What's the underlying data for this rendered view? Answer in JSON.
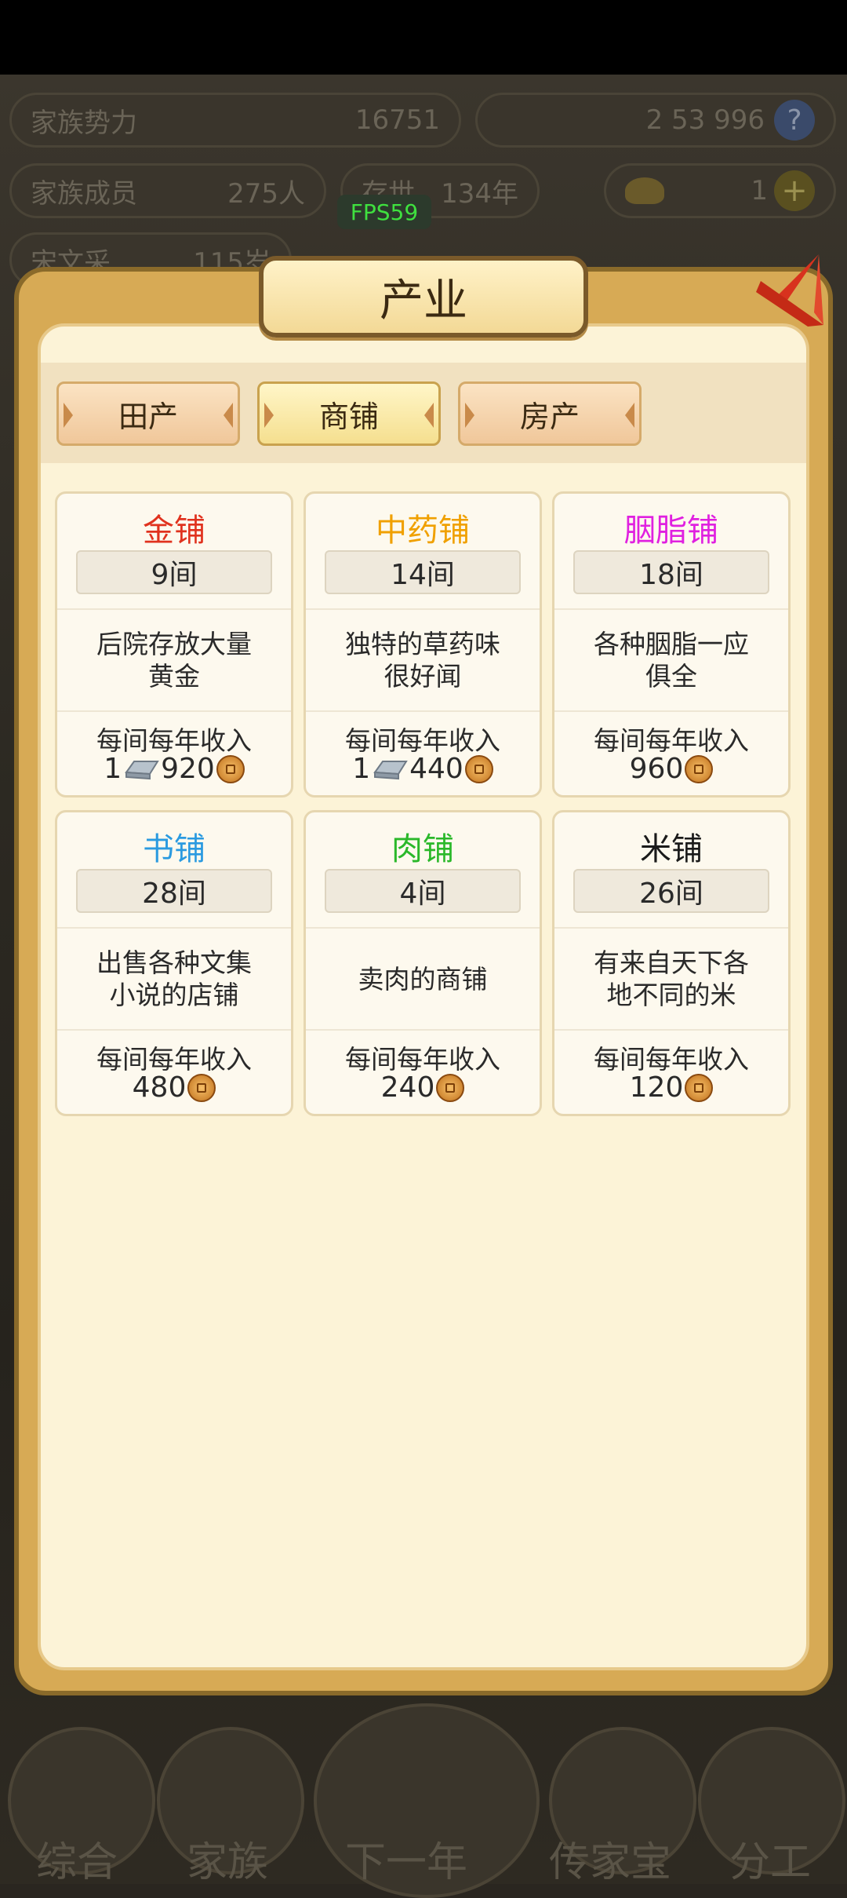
{
  "hud": {
    "family_power_label": "家族势力",
    "family_power_value": "16751",
    "family_members_label": "家族成员",
    "family_members_value": "275人",
    "alive_label": "存世",
    "alive_value": "134年",
    "patriarch_name": "宋文采",
    "patriarch_age": "115岁",
    "currency_text": "2 53 996",
    "ingot_count": "1",
    "fps": "FPS59"
  },
  "panel": {
    "title": "产业",
    "tabs": [
      {
        "label": "田产",
        "active": false
      },
      {
        "label": "商铺",
        "active": true
      },
      {
        "label": "房产",
        "active": false
      }
    ]
  },
  "shops": [
    {
      "name": "金铺",
      "color": "#e0321e",
      "count": "9间",
      "desc": "后院存放大量黄金",
      "income_label": "每间每年收入",
      "income_prefix": "1",
      "has_silver": true,
      "income": "920"
    },
    {
      "name": "中药铺",
      "color": "#f0a000",
      "count": "14间",
      "desc": "独特的草药味很好闻",
      "income_label": "每间每年收入",
      "income_prefix": "1",
      "has_silver": true,
      "income": "440"
    },
    {
      "name": "胭脂铺",
      "color": "#e020e0",
      "count": "18间",
      "desc": "各种胭脂一应俱全",
      "income_label": "每间每年收入",
      "income_prefix": "",
      "has_silver": false,
      "income": "960"
    },
    {
      "name": "书铺",
      "color": "#2a9ae0",
      "count": "28间",
      "desc": "出售各种文集小说的店铺",
      "income_label": "每间每年收入",
      "income_prefix": "",
      "has_silver": false,
      "income": "480"
    },
    {
      "name": "肉铺",
      "color": "#2ab82a",
      "count": "4间",
      "desc": "卖肉的商铺",
      "income_label": "每间每年收入",
      "income_prefix": "",
      "has_silver": false,
      "income": "240"
    },
    {
      "name": "米铺",
      "color": "#1a1a1a",
      "count": "26间",
      "desc": "有来自天下各地不同的米",
      "income_label": "每间每年收入",
      "income_prefix": "",
      "has_silver": false,
      "income": "120"
    }
  ],
  "bottom_nav": [
    {
      "label": "综合"
    },
    {
      "label": "家族"
    },
    {
      "label": "下一年"
    },
    {
      "label": "传家宝"
    },
    {
      "label": "分工"
    }
  ]
}
